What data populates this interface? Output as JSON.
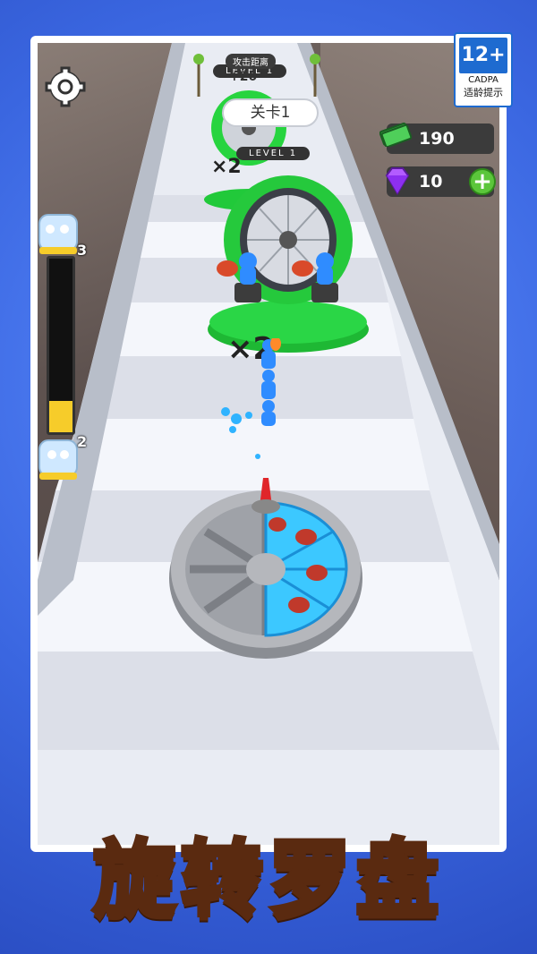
{
  "hud": {
    "cash_value": "190",
    "gem_value": "10",
    "plus_label": "+",
    "settings_icon": "gear-icon",
    "cash_icon": "cash-stack-icon",
    "gem_icon": "purple-gem-icon"
  },
  "rating": {
    "age": "12+",
    "org": "CADPA",
    "tip": "适龄提示"
  },
  "level": {
    "label": "关卡1",
    "gate_level_near": "LEVEL 1",
    "gate_level_far": "LEVEL 1",
    "attack_distance": "攻击距离",
    "far_bonus": "+20"
  },
  "crowd": {
    "top_jar_count": "3",
    "bottom_jar_count": "2",
    "progress_fraction": 0.18
  },
  "gates": {
    "multiplier_near": "×2",
    "multiplier_far": "×2"
  },
  "wheel": {
    "segments_filled": 3,
    "segment_icon": "meat-drumstick-icon"
  },
  "title": "旋转罗盘",
  "colors": {
    "accent_green": "#5bc63b",
    "title_gold": "#ffc21a",
    "progress_yellow": "#f6cc2a",
    "rating_blue": "#1e6bd0"
  }
}
